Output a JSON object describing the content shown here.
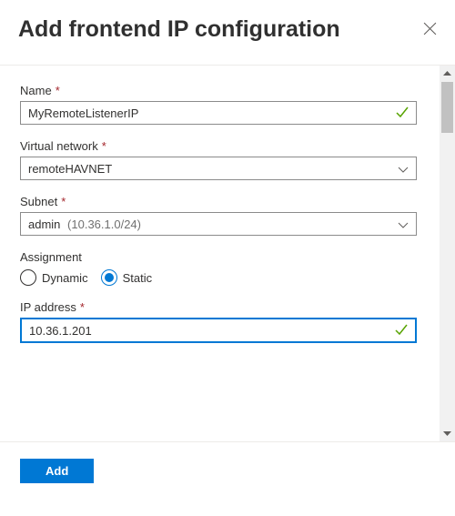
{
  "header": {
    "title": "Add frontend IP configuration"
  },
  "fields": {
    "name": {
      "label": "Name",
      "required": true,
      "value": "MyRemoteListenerIP",
      "validated": true
    },
    "vnet": {
      "label": "Virtual network",
      "required": true,
      "value": "remoteHAVNET"
    },
    "subnet": {
      "label": "Subnet",
      "required": true,
      "value": "admin",
      "suffix": "(10.36.1.0/24)"
    },
    "assignment": {
      "label": "Assignment",
      "options": {
        "dynamic": "Dynamic",
        "static": "Static"
      },
      "selected": "static"
    },
    "ip": {
      "label": "IP address",
      "required": true,
      "value": "10.36.1.201",
      "validated": true
    }
  },
  "footer": {
    "add_label": "Add"
  },
  "required_char": "*"
}
